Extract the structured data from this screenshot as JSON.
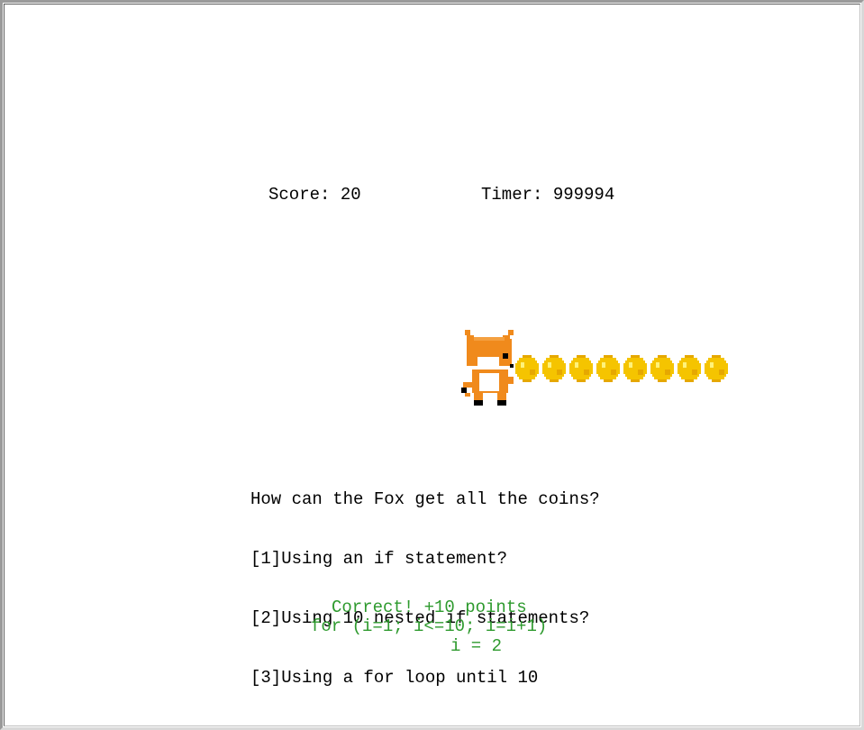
{
  "hud": {
    "score_text": "Score: 20",
    "timer_text": "Timer: 999994"
  },
  "game": {
    "player": "fox-sprite",
    "coins_remaining": 8,
    "coin_color": "#f5c400",
    "fox_color": "#f08a1c"
  },
  "question": {
    "prompt": "How can the Fox get all the coins?",
    "options": [
      "[1]Using an if statement?",
      "[2]Using 10 nested if statements?",
      "[3]Using a for loop until 10"
    ]
  },
  "feedback": {
    "result": "Correct! +10 points",
    "code": "for (i=1; i<=10; i=i+1)",
    "counter": "i = 2",
    "color": "#2e9a2e"
  }
}
